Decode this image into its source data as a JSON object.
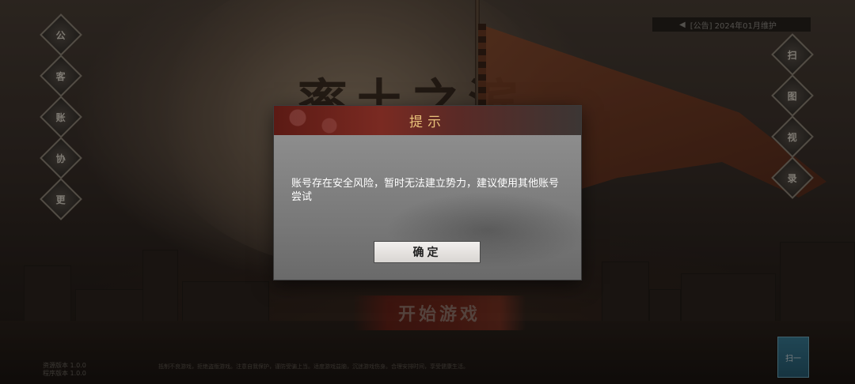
{
  "background": {
    "calligraphy_title": "率土之滨",
    "start_button_label": "开始游戏",
    "top_strip_text": "[公告] 2024年01月维护",
    "left_icons": [
      "公",
      "客",
      "账",
      "协",
      "更"
    ],
    "right_icons": [
      "扫",
      "图",
      "视",
      "录"
    ],
    "corner_badge": "扫一",
    "version_text": [
      "资源版本 1.0.0",
      "程序版本 1.0.0"
    ],
    "legal_text": "抵制不良游戏，拒绝盗版游戏。注意自我保护，谨防受骗上当。适度游戏益脑，沉迷游戏伤身。合理安排时间，享受健康生活。"
  },
  "dialog": {
    "title": "提示",
    "message": "账号存在安全风险，暂时无法建立势力，建议使用其他账号尝试",
    "confirm_label": "确定"
  },
  "colors": {
    "dialog_title": "#e9c27a",
    "header_red": "#7a2a22",
    "start_red": "#8a2a1c"
  }
}
